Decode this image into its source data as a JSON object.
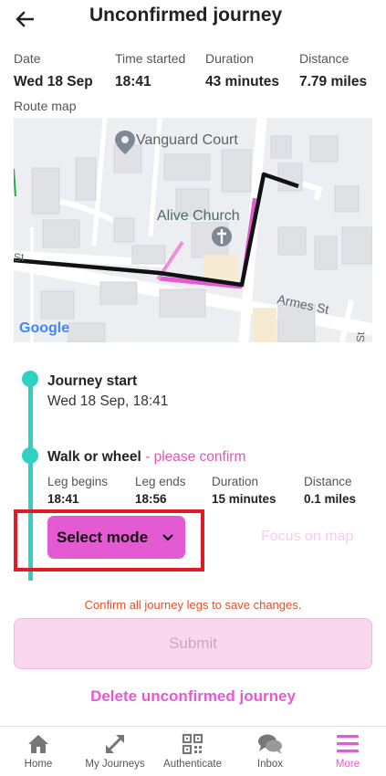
{
  "header": {
    "title": "Unconfirmed journey",
    "back_icon": "arrow-left-icon"
  },
  "summary": {
    "date": {
      "label": "Date",
      "value": "Wed 18 Sep"
    },
    "time_started": {
      "label": "Time started",
      "value": "18:41"
    },
    "duration": {
      "label": "Duration",
      "value": "43 minutes"
    },
    "distance": {
      "label": "Distance",
      "value": "7.79 miles"
    }
  },
  "route_map": {
    "label": "Route map",
    "places": {
      "poi_1": "Vanguard Court",
      "poi_2": "Alive Church",
      "street": "Armes St",
      "street_fragment_left": "St",
      "street_fragment_right": "St"
    },
    "attribution": "Google"
  },
  "timeline": {
    "journey_start": {
      "title": "Journey start",
      "datetime": "Wed 18 Sep, 18:41"
    },
    "leg": {
      "title": "Walk or wheel",
      "confirm_note": " - please confirm",
      "leg_begins": {
        "label": "Leg begins",
        "value": "18:41"
      },
      "leg_ends": {
        "label": "Leg ends",
        "value": "18:56"
      },
      "duration": {
        "label": "Duration",
        "value": "15 minutes"
      },
      "distance": {
        "label": "Distance",
        "value": "0.1 miles"
      },
      "select_mode_label": "Select mode",
      "focus_map_label": "Focus on map"
    }
  },
  "warning": "Confirm all journey legs to save changes.",
  "submit_label": "Submit",
  "delete_label": "Delete unconfirmed journey",
  "bottom_nav": [
    {
      "label": "Home",
      "icon": "home-icon",
      "active": false
    },
    {
      "label": "My Journeys",
      "icon": "expand-arrows-icon",
      "active": false
    },
    {
      "label": "Authenticate",
      "icon": "qr-code-icon",
      "active": false
    },
    {
      "label": "Inbox",
      "icon": "chat-bubbles-icon",
      "active": false
    },
    {
      "label": "More",
      "icon": "menu-icon",
      "active": true
    }
  ],
  "colors": {
    "accent": "#e45ad2",
    "timeline": "#2fd1c3",
    "warning": "#e0522c",
    "highlight": "#e01b24",
    "submit_disabled_bg": "#fbd6ef"
  }
}
